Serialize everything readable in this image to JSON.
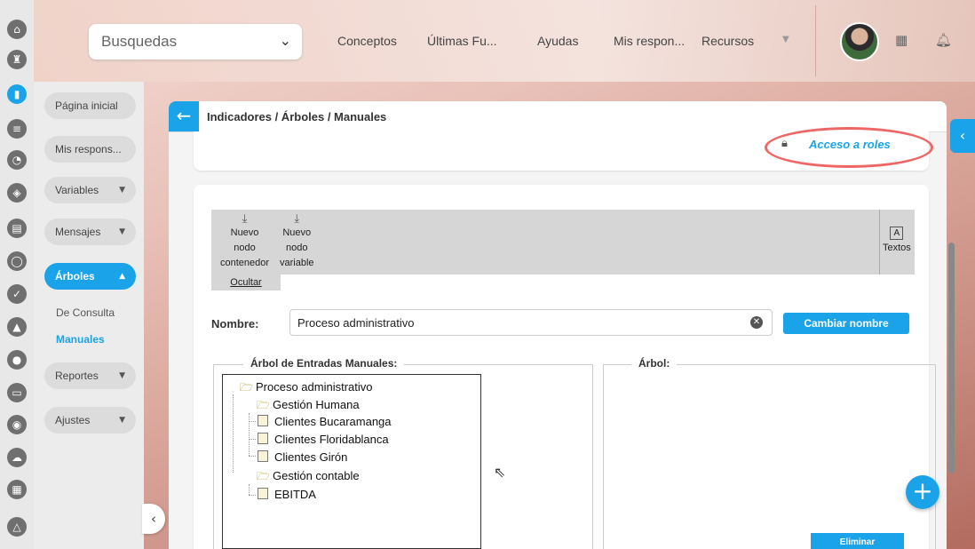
{
  "header": {
    "search_label": "Busquedas",
    "nav": [
      "Conceptos",
      "Últimas Fu...",
      "Ayudas",
      "Mis respon...",
      "Recursos"
    ]
  },
  "rail_icons": [
    "home-icon",
    "castle-icon",
    "chart-icon",
    "list-icon",
    "pie-icon",
    "shield-icon",
    "document-icon",
    "circle-icon",
    "check-icon",
    "warning-icon",
    "users-icon",
    "monitor-icon",
    "target-icon",
    "cloud-icon",
    "calendar-icon",
    "network-icon"
  ],
  "sidebar": {
    "items": [
      {
        "label": "Página inicial"
      },
      {
        "label": "Mis respons..."
      },
      {
        "label": "Variables"
      },
      {
        "label": "Mensajes"
      },
      {
        "label": "Árboles"
      },
      {
        "label": "Reportes"
      },
      {
        "label": "Ajustes"
      }
    ],
    "sub_items": [
      "De Consulta",
      "Manuales"
    ]
  },
  "page": {
    "breadcrumb": "Indicadores / Árboles / Manuales",
    "roles_link": "Acceso a roles"
  },
  "toolbar": {
    "container": [
      "Nuevo",
      "nodo",
      "contenedor"
    ],
    "variable": [
      "Nuevo",
      "nodo",
      "variable"
    ],
    "texts": "Textos",
    "hide": "Ocultar"
  },
  "form": {
    "name_label": "Nombre:",
    "name_value": "Proceso administrativo",
    "rename_button": "Cambiar nombre"
  },
  "tree_panel": {
    "legend": "Árbol de Entradas Manuales:",
    "nodes": [
      {
        "label": "Proceso administrativo",
        "type": "folder"
      },
      {
        "label": "Gestión Humana",
        "type": "folder"
      },
      {
        "label": "Clientes Bucaramanga",
        "type": "doc"
      },
      {
        "label": "Clientes Floridablanca",
        "type": "doc"
      },
      {
        "label": "Clientes Girón",
        "type": "doc"
      },
      {
        "label": "Gestión contable",
        "type": "folder"
      },
      {
        "label": "EBITDA",
        "type": "doc"
      }
    ]
  },
  "right_panel": {
    "legend": "Árbol:",
    "delete_button": "Eliminar"
  },
  "colors": {
    "accent": "#1aa3e8",
    "highlight": "#ee6666"
  }
}
